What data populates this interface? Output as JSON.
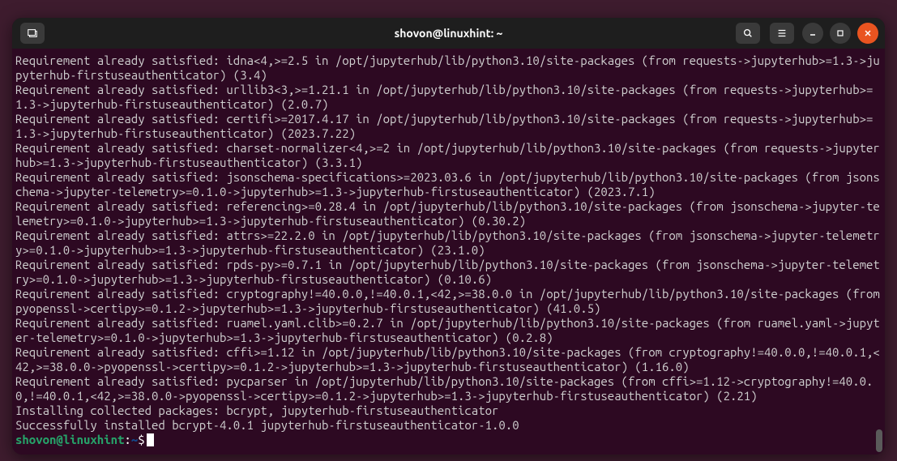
{
  "titlebar": {
    "title": "shovon@linuxhint: ~"
  },
  "terminal": {
    "lines": [
      "Requirement already satisfied: idna<4,>=2.5 in /opt/jupyterhub/lib/python3.10/site-packages (from requests->jupyterhub>=1.3->jupyterhub-firstuseauthenticator) (3.4)",
      "Requirement already satisfied: urllib3<3,>=1.21.1 in /opt/jupyterhub/lib/python3.10/site-packages (from requests->jupyterhub>=1.3->jupyterhub-firstuseauthenticator) (2.0.7)",
      "Requirement already satisfied: certifi>=2017.4.17 in /opt/jupyterhub/lib/python3.10/site-packages (from requests->jupyterhub>=1.3->jupyterhub-firstuseauthenticator) (2023.7.22)",
      "Requirement already satisfied: charset-normalizer<4,>=2 in /opt/jupyterhub/lib/python3.10/site-packages (from requests->jupyterhub>=1.3->jupyterhub-firstuseauthenticator) (3.3.1)",
      "Requirement already satisfied: jsonschema-specifications>=2023.03.6 in /opt/jupyterhub/lib/python3.10/site-packages (from jsonschema->jupyter-telemetry>=0.1.0->jupyterhub>=1.3->jupyterhub-firstuseauthenticator) (2023.7.1)",
      "Requirement already satisfied: referencing>=0.28.4 in /opt/jupyterhub/lib/python3.10/site-packages (from jsonschema->jupyter-telemetry>=0.1.0->jupyterhub>=1.3->jupyterhub-firstuseauthenticator) (0.30.2)",
      "Requirement already satisfied: attrs>=22.2.0 in /opt/jupyterhub/lib/python3.10/site-packages (from jsonschema->jupyter-telemetry>=0.1.0->jupyterhub>=1.3->jupyterhub-firstuseauthenticator) (23.1.0)",
      "Requirement already satisfied: rpds-py>=0.7.1 in /opt/jupyterhub/lib/python3.10/site-packages (from jsonschema->jupyter-telemetry>=0.1.0->jupyterhub>=1.3->jupyterhub-firstuseauthenticator) (0.10.6)",
      "Requirement already satisfied: cryptography!=40.0.0,!=40.0.1,<42,>=38.0.0 in /opt/jupyterhub/lib/python3.10/site-packages (from pyopenssl->certipy>=0.1.2->jupyterhub>=1.3->jupyterhub-firstuseauthenticator) (41.0.5)",
      "Requirement already satisfied: ruamel.yaml.clib>=0.2.7 in /opt/jupyterhub/lib/python3.10/site-packages (from ruamel.yaml->jupyter-telemetry>=0.1.0->jupyterhub>=1.3->jupyterhub-firstuseauthenticator) (0.2.8)",
      "Requirement already satisfied: cffi>=1.12 in /opt/jupyterhub/lib/python3.10/site-packages (from cryptography!=40.0.0,!=40.0.1,<42,>=38.0.0->pyopenssl->certipy>=0.1.2->jupyterhub>=1.3->jupyterhub-firstuseauthenticator) (1.16.0)",
      "Requirement already satisfied: pycparser in /opt/jupyterhub/lib/python3.10/site-packages (from cffi>=1.12->cryptography!=40.0.0,!=40.0.1,<42,>=38.0.0->pyopenssl->certipy>=0.1.2->jupyterhub>=1.3->jupyterhub-firstuseauthenticator) (2.21)",
      "Installing collected packages: bcrypt, jupyterhub-firstuseauthenticator",
      "Successfully installed bcrypt-4.0.1 jupyterhub-firstuseauthenticator-1.0.0"
    ],
    "prompt": {
      "user_host": "shovon@linuxhint",
      "path": "~",
      "symbol": "$"
    }
  }
}
